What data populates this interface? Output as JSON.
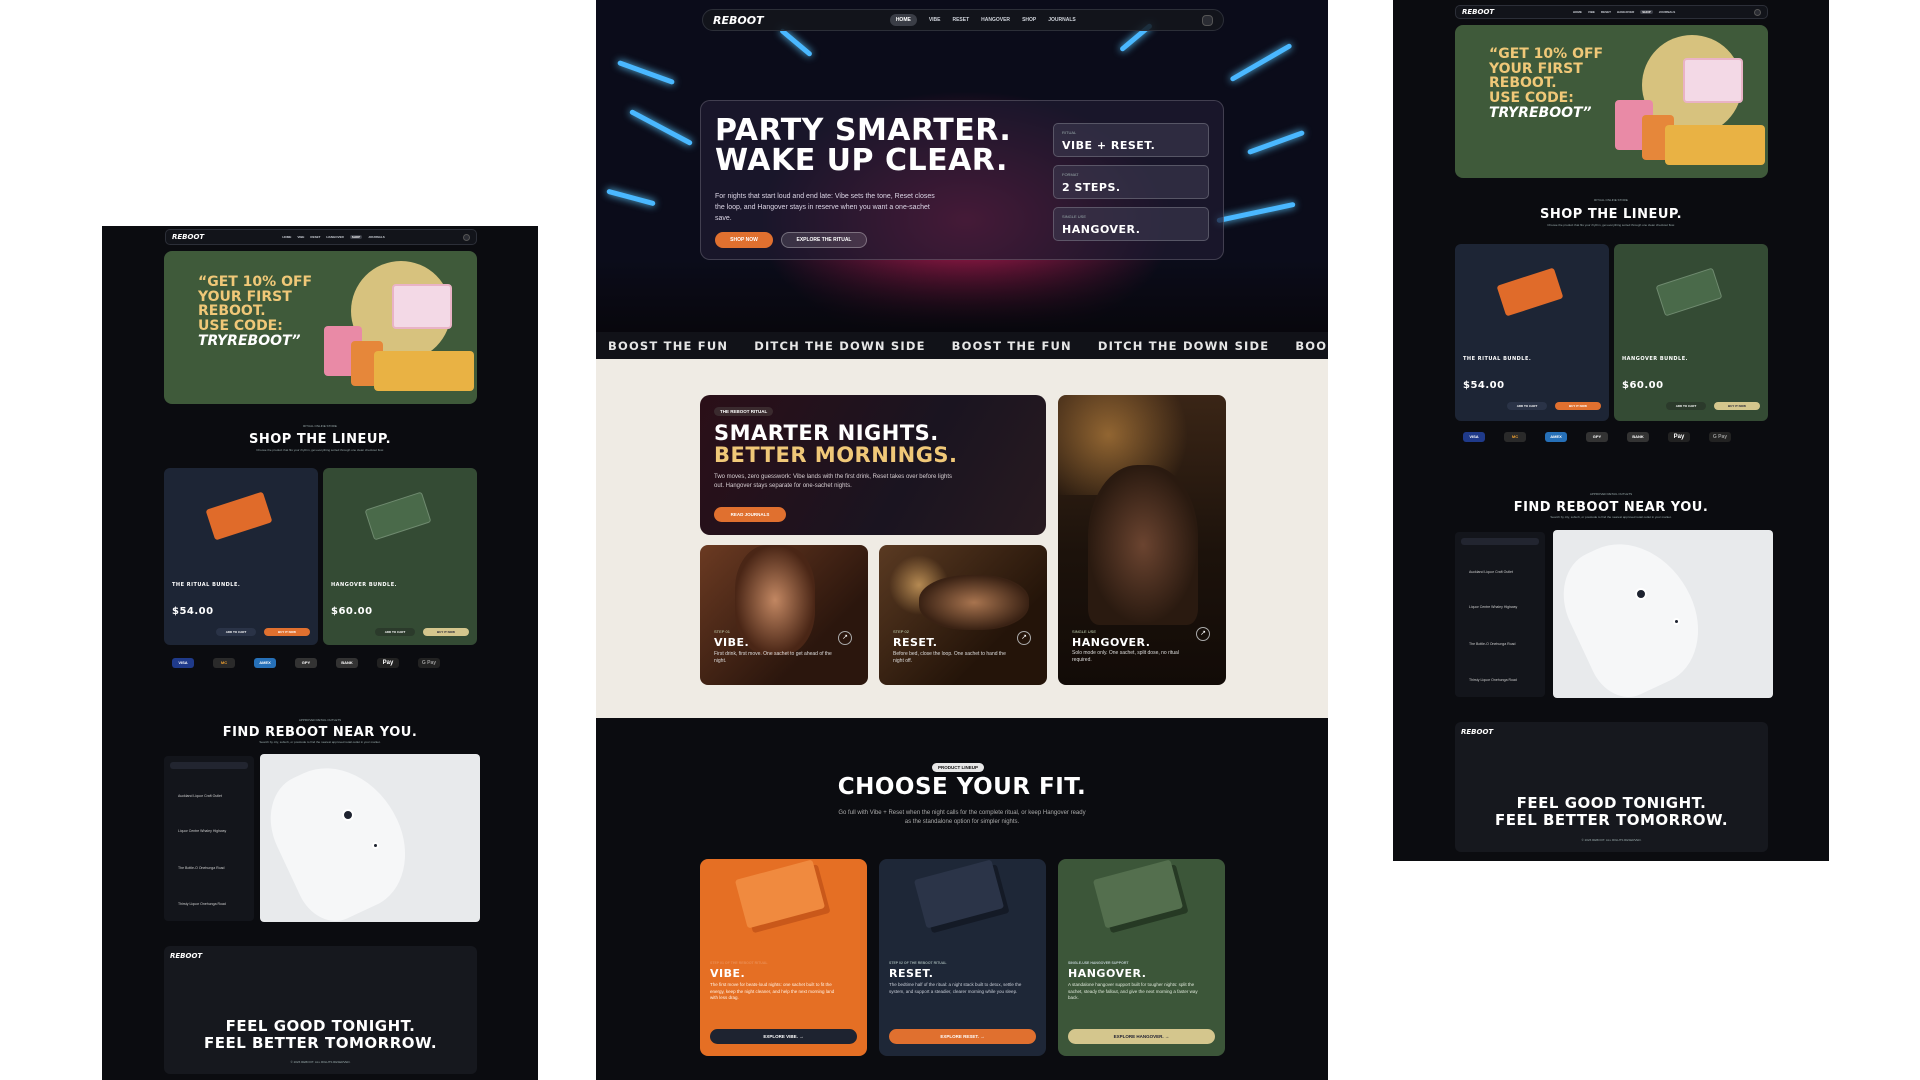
{
  "brand": {
    "logo": "REBOOT"
  },
  "nav": {
    "items": [
      "HOME",
      "VIBE",
      "RESET",
      "HANGOVER",
      "SHOP",
      "JOURNALS"
    ],
    "active": "HOME",
    "active_side": "SHOP"
  },
  "promo": {
    "line1": "“GET 10% OFF",
    "line2": "YOUR FIRST",
    "line3": "REBOOT.",
    "line4": "USE CODE:",
    "code": "TRYREBOOT”"
  },
  "shop": {
    "eyebrow": "RITUAL ONLINE STORE",
    "title": "SHOP THE LINEUP.",
    "sub": "Choose the product that fits your rhythm, get everything sorted through one clean checkout flow.",
    "products": [
      {
        "name": "THE RITUAL BUNDLE.",
        "price": "$54.00",
        "add": "ADD TO CART",
        "buy": "BUY IT NOW"
      },
      {
        "name": "HANGOVER BUNDLE.",
        "price": "$60.00",
        "add": "ADD TO CART",
        "buy": "BUY IT NOW"
      }
    ],
    "payments": [
      "VISA",
      "MC",
      "AMEX",
      "GPY",
      "BANK",
      "Pay",
      "G Pay"
    ]
  },
  "finder": {
    "eyebrow": "APPROVED RETAIL OUTLETS",
    "title": "FIND REBOOT NEAR YOU.",
    "sub": "Search by city, suburb, or postcode to find the nearest approved retail outlet in your market.",
    "stores": [
      "Auckland Liquor Craft Outlet",
      "Liquor Centre Whaley Highway",
      "The Bottle-O Onehunga Road",
      "Thirsty Liquor Onehunga Road"
    ]
  },
  "footer": {
    "line1": "FEEL GOOD TONIGHT.",
    "line2": "FEEL BETTER TOMORROW.",
    "rights": "© 2026 REBOOT. ALL RIGHTS RESERVED."
  },
  "hero": {
    "title1": "PARTY SMARTER.",
    "title2": "WAKE UP CLEAR.",
    "body": "For nights that start loud and end late: Vibe sets the tone, Reset closes the loop, and Hangover stays in reserve when you want a one-sachet save.",
    "cta1": "SHOP NOW",
    "cta2": "EXPLORE THE RITUAL",
    "stats": [
      {
        "k": "RITUAL",
        "v": "VIBE + RESET."
      },
      {
        "k": "FORMAT",
        "v": "2 STEPS."
      },
      {
        "k": "SINGLE USE",
        "v": "HANGOVER."
      }
    ]
  },
  "marquee": [
    "BOOST THE FUN",
    "DITCH THE DOWN SIDE",
    "BOOST THE FUN",
    "DITCH THE DOWN SIDE",
    "BOOST THE"
  ],
  "ritual": {
    "eyebrow": "THE REBOOT RITUAL",
    "title1": "SMARTER NIGHTS.",
    "title2": "BETTER MORNINGS.",
    "body": "Two moves, zero guesswork: Vibe lands with the first drink, Reset takes over before lights out. Hangover stays separate for one-sachet nights.",
    "cta": "READ JOURNALS",
    "tiles": [
      {
        "k": "STEP 01",
        "t": "VIBE.",
        "d": "First drink, first move. One sachet to get ahead of the night."
      },
      {
        "k": "STEP 02",
        "t": "RESET.",
        "d": "Before bed, close the loop. One sachet to hand the night off."
      },
      {
        "k": "SINGLE USE",
        "t": "HANGOVER.",
        "d": "Solo mode only. One sachet, split dose, no ritual required."
      }
    ]
  },
  "fit": {
    "eyebrow": "PRODUCT LINEUP",
    "title": "CHOOSE YOUR FIT.",
    "sub1": "Go full with Vibe + Reset when the night calls for the complete ritual, or keep Hangover ready",
    "sub2": "as the standalone option for simpler nights.",
    "cards": [
      {
        "k": "STEP 01 OF THE REBOOT RITUAL",
        "t": "VIBE.",
        "d": "The first move for beats-loud nights: one sachet built to fit the energy, keep the night cleaner, and help the next morning land with less drag.",
        "cta": "EXPLORE VIBE.  →"
      },
      {
        "k": "STEP 02 OF THE REBOOT RITUAL",
        "t": "RESET.",
        "d": "The bedtime half of the ritual: a night stack built to detox, settle the system, and support a steadier, clearer morning while you sleep.",
        "cta": "EXPLORE RESET.  →"
      },
      {
        "k": "SINGLE-USE HANGOVER SUPPORT",
        "t": "HANGOVER.",
        "d": "A standalone hangover support built for tougher nights: split the sachet, steady the fallout, and give the next morning a faster way back.",
        "cta": "EXPLORE HANGOVER.  →"
      }
    ]
  }
}
